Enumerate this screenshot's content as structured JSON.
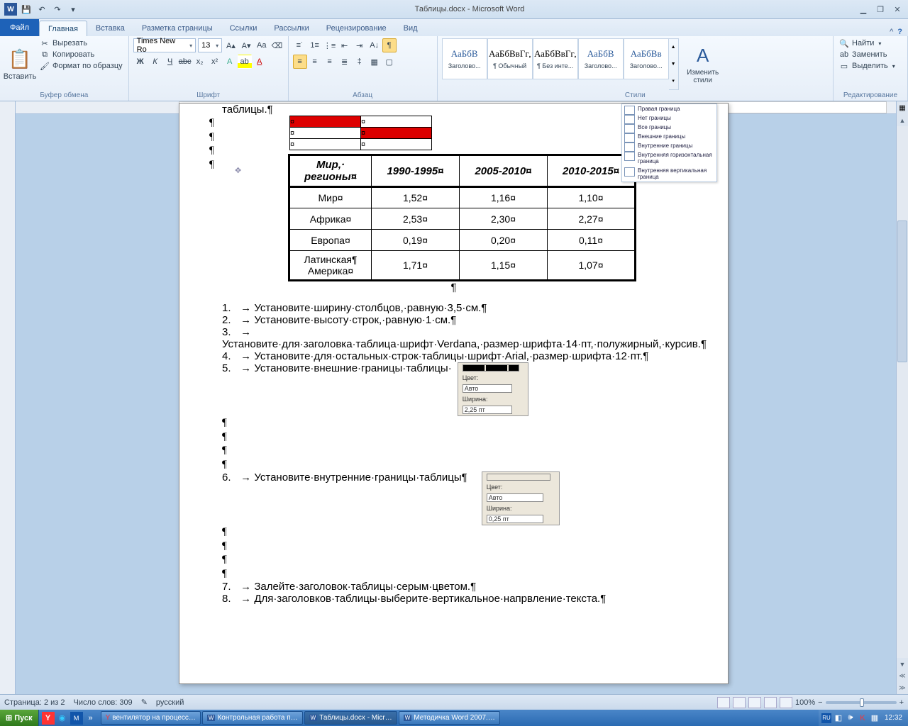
{
  "app": {
    "title": "Таблицы.docx - Microsoft Word"
  },
  "tabs": {
    "file": "Файл",
    "items": [
      "Главная",
      "Вставка",
      "Разметка страницы",
      "Ссылки",
      "Рассылки",
      "Рецензирование",
      "Вид"
    ],
    "active": 0
  },
  "ribbon": {
    "clipboard": {
      "paste": "Вставить",
      "cut": "Вырезать",
      "copy": "Копировать",
      "format_painter": "Формат по образцу",
      "title": "Буфер обмена"
    },
    "font": {
      "name": "Times New Ro",
      "size": "13",
      "title": "Шрифт"
    },
    "paragraph": {
      "title": "Абзац"
    },
    "styles": {
      "title": "Стили",
      "items": [
        {
          "preview": "АаБбВ",
          "label": "Заголово..."
        },
        {
          "preview": "АаБбВвГг,",
          "label": "¶ Обычный"
        },
        {
          "preview": "АаБбВвГг,",
          "label": "¶ Без инте..."
        },
        {
          "preview": "АаБбВ",
          "label": "Заголово..."
        },
        {
          "preview": "АаБбВв",
          "label": "Заголово..."
        }
      ],
      "change_styles": "Изменить\nстили"
    },
    "editing": {
      "find": "Найти",
      "replace": "Заменить",
      "select": "Выделить",
      "title": "Редактирование"
    }
  },
  "doc": {
    "top_label": "таблицы.¶",
    "border_menu": [
      "Правая граница",
      "Нет границы",
      "Все границы",
      "Внешние границы",
      "Внутренние границы",
      "Внутренняя горизонтальная граница",
      "Внутренняя вертикальная граница"
    ],
    "table": {
      "headers": [
        "Мир,·\nрегионы¤",
        "1990-1995¤",
        "2005-2010¤",
        "2010-2015¤"
      ],
      "rows": [
        [
          "Мир¤",
          "1,52¤",
          "1,16¤",
          "1,10¤"
        ],
        [
          "Африка¤",
          "2,53¤",
          "2,30¤",
          "2,27¤"
        ],
        [
          "Европа¤",
          "0,19¤",
          "0,20¤",
          "0,11¤"
        ],
        [
          "Латинская¶\nАмерика¤",
          "1,71¤",
          "1,15¤",
          "1,07¤"
        ]
      ]
    },
    "list": [
      "Установите·ширину·столбцов,·равную·3,5·см.¶",
      "Установите·высоту·строк,·равную·1·см.¶",
      "Установите·для·заголовка·таблица·шрифт·Verdana,·размер·шрифта·14·пт,·полужирный,·курсив.¶",
      "Установите·для·остальных·строк·таблицы·шрифт·Arial,·размер·шрифта·12·пт.¶",
      "Установите·внешние·границы·таблицы·",
      "Установите·внутренние·границы·таблицы¶",
      "Залейте·заголовок·таблицы·серым·цветом.¶",
      "Для·заголовков·таблицы·выберите·вертикальное·напрвление·текста.¶"
    ],
    "border_widget": {
      "color_lbl": "Цвет:",
      "color_val": "Авто",
      "width_lbl": "Ширина:",
      "w1": "2,25 пт",
      "w2": "0,25 пт"
    }
  },
  "status": {
    "page": "Страница: 2 из 2",
    "words": "Число слов: 309",
    "lang": "русский",
    "zoom": "100%"
  },
  "taskbar": {
    "start": "Пуск",
    "items": [
      "вентилятор на процесс…",
      "Контрольная работа п…",
      "Таблицы.docx - Micr…",
      "Методичка Word 2007.…"
    ],
    "clock": "12:32"
  }
}
